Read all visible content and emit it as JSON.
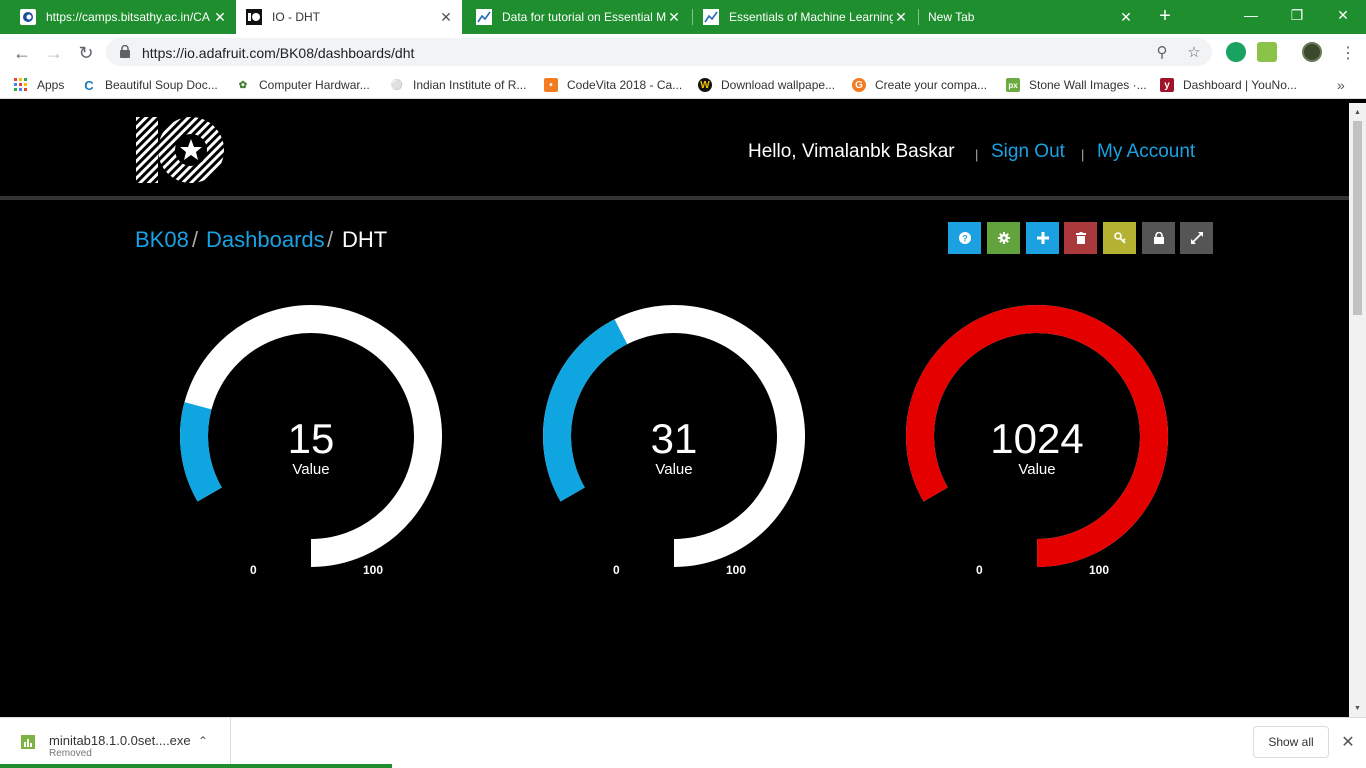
{
  "browser": {
    "tabs": [
      {
        "title": "https://camps.bitsathy.ac.in/CA",
        "active": false
      },
      {
        "title": "IO - DHT",
        "active": true
      },
      {
        "title": "Data for tutorial on Essential M",
        "active": false
      },
      {
        "title": "Essentials of Machine Learning",
        "active": false
      },
      {
        "title": "New Tab",
        "active": false
      }
    ],
    "url": "https://io.adafruit.com/BK08/dashboards/dht",
    "bookmarks": [
      {
        "label": "Apps"
      },
      {
        "label": "Beautiful Soup Doc..."
      },
      {
        "label": "Computer Hardwar..."
      },
      {
        "label": "Indian Institute of R..."
      },
      {
        "label": "CodeVita 2018 - Ca..."
      },
      {
        "label": "Download wallpape..."
      },
      {
        "label": "Create your compa..."
      },
      {
        "label": "Stone Wall Images ·..."
      },
      {
        "label": "Dashboard | YouNo..."
      }
    ]
  },
  "header": {
    "greeting": "Hello, Vimalanbk Baskar",
    "separator": "|",
    "sign_out": "Sign Out",
    "my_account": "My Account"
  },
  "breadcrumb": {
    "user": "BK08",
    "slash": "/",
    "dashboards": "Dashboards",
    "current": "DHT"
  },
  "toolbar_buttons": [
    {
      "name": "help",
      "icon": "question-icon",
      "color": "#1ba1e2"
    },
    {
      "name": "settings",
      "icon": "gear-icon",
      "color": "#63a33d"
    },
    {
      "name": "add",
      "icon": "plus-icon",
      "color": "#1ba1e2"
    },
    {
      "name": "delete",
      "icon": "trash-icon",
      "color": "#a9393a"
    },
    {
      "name": "key",
      "icon": "key-icon",
      "color": "#b5b233"
    },
    {
      "name": "lock",
      "icon": "lock-icon",
      "color": "#555555"
    },
    {
      "name": "fullscreen",
      "icon": "expand-icon",
      "color": "#555555"
    }
  ],
  "gauges": [
    {
      "value": "15",
      "label": "Value",
      "min": "0",
      "max": "100",
      "fill_fraction": 0.15,
      "fill_color": "#0ea5e0",
      "track_color": "#ffffff"
    },
    {
      "value": "31",
      "label": "Value",
      "min": "0",
      "max": "100",
      "fill_fraction": 0.31,
      "fill_color": "#0ea5e0",
      "track_color": "#ffffff"
    },
    {
      "value": "1024",
      "label": "Value",
      "min": "0",
      "max": "100",
      "fill_fraction": 1.0,
      "fill_color": "#e50000",
      "track_color": "#ffffff"
    }
  ],
  "download": {
    "filename": "minitab18.1.0.0set....exe",
    "status": "Removed",
    "show_all": "Show all"
  }
}
